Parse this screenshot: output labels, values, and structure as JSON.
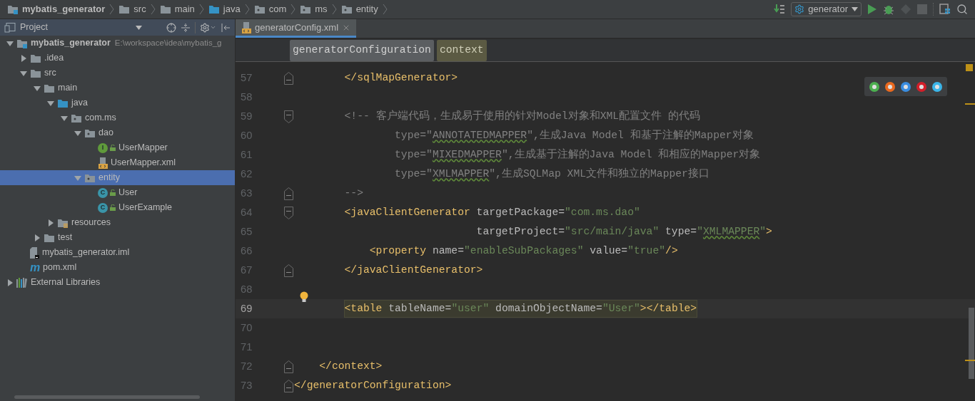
{
  "navbar": {
    "crumbs": [
      {
        "label": "mybatis_generator",
        "kind": "module"
      },
      {
        "label": "src",
        "kind": "folder"
      },
      {
        "label": "main",
        "kind": "folder"
      },
      {
        "label": "java",
        "kind": "source"
      },
      {
        "label": "com",
        "kind": "package"
      },
      {
        "label": "ms",
        "kind": "package"
      },
      {
        "label": "entity",
        "kind": "package"
      }
    ],
    "run_config": "generator"
  },
  "project_panel": {
    "title": "Project",
    "tree": [
      {
        "name": "mybatis_generator",
        "kind": "module",
        "path": "E:\\workspace\\idea\\mybatis_g",
        "expanded": true,
        "selected": false,
        "children": [
          {
            "name": ".idea",
            "kind": "folder",
            "expanded": false,
            "selected": false
          },
          {
            "name": "src",
            "kind": "folder",
            "expanded": true,
            "selected": false,
            "children": [
              {
                "name": "main",
                "kind": "folder",
                "expanded": true,
                "selected": false,
                "children": [
                  {
                    "name": "java",
                    "kind": "source",
                    "expanded": true,
                    "selected": false,
                    "children": [
                      {
                        "name": "com.ms",
                        "kind": "package",
                        "expanded": true,
                        "selected": false,
                        "children": [
                          {
                            "name": "dao",
                            "kind": "package",
                            "expanded": true,
                            "selected": false,
                            "children": [
                              {
                                "name": "UserMapper",
                                "kind": "interface",
                                "badge": "I",
                                "selected": false
                              },
                              {
                                "name": "UserMapper.xml",
                                "kind": "xml",
                                "selected": false
                              }
                            ]
                          },
                          {
                            "name": "entity",
                            "kind": "package",
                            "expanded": true,
                            "selected": true,
                            "children": [
                              {
                                "name": "User",
                                "kind": "class",
                                "badge": "C",
                                "selected": false
                              },
                              {
                                "name": "UserExample",
                                "kind": "class",
                                "badge": "C",
                                "selected": false
                              }
                            ]
                          }
                        ]
                      }
                    ]
                  },
                  {
                    "name": "resources",
                    "kind": "resources",
                    "expanded": false,
                    "selected": false
                  }
                ]
              },
              {
                "name": "test",
                "kind": "folder",
                "expanded": false,
                "selected": false
              }
            ]
          },
          {
            "name": "mybatis_generator.iml",
            "kind": "file",
            "selected": false
          },
          {
            "name": "pom.xml",
            "kind": "maven",
            "badge": "m",
            "selected": false
          }
        ]
      },
      {
        "name": "External Libraries",
        "kind": "library",
        "expanded": false,
        "selected": false
      }
    ]
  },
  "editor": {
    "tabs": [
      {
        "label": "generatorConfig.xml",
        "selected": true
      }
    ],
    "breadcrumbs": [
      {
        "label": "generatorConfiguration",
        "selected": false
      },
      {
        "label": "context",
        "selected": true
      }
    ],
    "lines": [
      {
        "number": "57",
        "kind": "fold_end",
        "highlighted": false,
        "hint": false,
        "tokens": [
          {
            "kind": "tag",
            "text": "        </sqlMapGenerator>"
          }
        ]
      },
      {
        "number": "58",
        "kind": "plain",
        "highlighted": false,
        "hint": false
      },
      {
        "number": "59",
        "kind": "fold_start",
        "highlighted": false,
        "hint": false,
        "tokens": [
          {
            "kind": "comment",
            "text": "        <!-- 客户端代码，生成易于使用的针对Model对象和XML配置文件 的代码"
          }
        ]
      },
      {
        "number": "60",
        "kind": "plain",
        "highlighted": false,
        "hint": false,
        "tokens": [
          {
            "kind": "comment",
            "text": "                type=\""
          },
          {
            "kind": "comment_warn",
            "text": "ANNOTATEDMAPPER"
          },
          {
            "kind": "comment",
            "text": "\",生成Java Model 和基于注解的Mapper对象"
          }
        ]
      },
      {
        "number": "61",
        "kind": "plain",
        "highlighted": false,
        "hint": false,
        "tokens": [
          {
            "kind": "comment",
            "text": "                type=\""
          },
          {
            "kind": "comment_warn",
            "text": "MIXEDMAPPER"
          },
          {
            "kind": "comment",
            "text": "\",生成基于注解的Java Model 和相应的Mapper对象"
          }
        ]
      },
      {
        "number": "62",
        "kind": "plain",
        "highlighted": false,
        "hint": false,
        "tokens": [
          {
            "kind": "comment",
            "text": "                type=\""
          },
          {
            "kind": "comment_warn",
            "text": "XMLMAPPER"
          },
          {
            "kind": "comment",
            "text": "\",生成SQLMap XML文件和独立的Mapper接口"
          }
        ]
      },
      {
        "number": "63",
        "kind": "fold_end",
        "highlighted": false,
        "hint": false,
        "tokens": [
          {
            "kind": "comment",
            "text": "        -->"
          }
        ]
      },
      {
        "number": "64",
        "kind": "fold_start",
        "highlighted": false,
        "hint": false,
        "tokens": [
          {
            "kind": "tag",
            "text": "        <javaClientGenerator"
          },
          {
            "kind": "attr",
            "text": " targetPackage="
          },
          {
            "kind": "value",
            "text": "\"com.ms.dao\""
          }
        ]
      },
      {
        "number": "65",
        "kind": "plain",
        "highlighted": false,
        "hint": false,
        "tokens": [
          {
            "kind": "attr",
            "text": "                             targetProject="
          },
          {
            "kind": "value",
            "text": "\"src/main/java\""
          },
          {
            "kind": "attr",
            "text": " type="
          },
          {
            "kind": "value",
            "text": "\""
          },
          {
            "kind": "value_warn",
            "text": "XMLMAPPER"
          },
          {
            "kind": "value",
            "text": "\""
          },
          {
            "kind": "tag",
            "text": ">"
          }
        ]
      },
      {
        "number": "66",
        "kind": "plain",
        "highlighted": false,
        "hint": false,
        "tokens": [
          {
            "kind": "tag",
            "text": "            <property"
          },
          {
            "kind": "attr",
            "text": " name="
          },
          {
            "kind": "value",
            "text": "\"enableSubPackages\""
          },
          {
            "kind": "attr",
            "text": " value="
          },
          {
            "kind": "value",
            "text": "\"true\""
          },
          {
            "kind": "tag",
            "text": "/>"
          }
        ]
      },
      {
        "number": "67",
        "kind": "fold_end",
        "highlighted": false,
        "hint": false,
        "tokens": [
          {
            "kind": "tag",
            "text": "        </javaClientGenerator>"
          }
        ]
      },
      {
        "number": "68",
        "kind": "plain",
        "highlighted": false,
        "hint": false
      },
      {
        "number": "69",
        "kind": "plain",
        "highlighted": true,
        "hint": true,
        "tokens": [
          {
            "kind": "tag",
            "text": "        <table"
          },
          {
            "kind": "attr",
            "text": " tableName="
          },
          {
            "kind": "value",
            "text": "\"user\""
          },
          {
            "kind": "attr",
            "text": " domainObjectName="
          },
          {
            "kind": "value",
            "text": "\"User\""
          },
          {
            "kind": "tag",
            "text": "></table>"
          }
        ]
      },
      {
        "number": "70",
        "kind": "plain",
        "highlighted": false,
        "hint": false
      },
      {
        "number": "71",
        "kind": "plain",
        "highlighted": false,
        "hint": false
      },
      {
        "number": "72",
        "kind": "fold_end",
        "highlighted": false,
        "hint": false,
        "tokens": [
          {
            "kind": "tag",
            "text": "    </context>"
          }
        ]
      },
      {
        "number": "73",
        "kind": "fold_end",
        "highlighted": false,
        "hint": false,
        "tokens": [
          {
            "kind": "tag",
            "text": "</generatorConfiguration>"
          }
        ]
      }
    ]
  }
}
